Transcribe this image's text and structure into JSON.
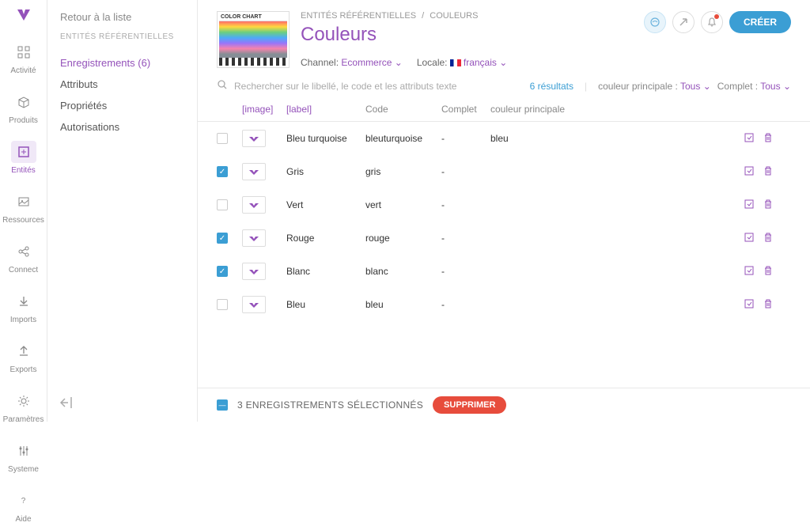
{
  "rail": [
    {
      "label": "Activité",
      "icon": "grid"
    },
    {
      "label": "Produits",
      "icon": "box"
    },
    {
      "label": "Entités",
      "icon": "bracket",
      "active": true
    },
    {
      "label": "Ressources",
      "icon": "image"
    },
    {
      "label": "Connect",
      "icon": "share"
    },
    {
      "label": "Imports",
      "icon": "download"
    },
    {
      "label": "Exports",
      "icon": "upload"
    },
    {
      "label": "Paramètres",
      "icon": "gear"
    },
    {
      "label": "Systeme",
      "icon": "sliders"
    }
  ],
  "rail_help": "Aide",
  "sidebar": {
    "back": "Retour à la liste",
    "section": "ENTITÉS RÉFÉRENTIELLES",
    "items": [
      {
        "label": "Enregistrements (6)",
        "active": true
      },
      {
        "label": "Attributs"
      },
      {
        "label": "Propriétés"
      },
      {
        "label": "Autorisations"
      }
    ]
  },
  "breadcrumb": {
    "parent": "ENTITÉS RÉFÉRENTIELLES",
    "current": "COULEURS"
  },
  "title": "Couleurs",
  "thumb_title": "COLOR CHART",
  "channel": {
    "label": "Channel:",
    "value": "Ecommerce"
  },
  "locale": {
    "label": "Locale:",
    "value": "français"
  },
  "create": "CRÉER",
  "search": {
    "placeholder": "Rechercher sur le libellé, le code et les attributs texte"
  },
  "results": "6 résultats",
  "filter1": {
    "label": "couleur principale :",
    "value": "Tous"
  },
  "filter2": {
    "label": "Complet :",
    "value": "Tous"
  },
  "columns": {
    "image": "[image]",
    "label": "[label]",
    "code": "Code",
    "complet": "Complet",
    "principale": "couleur principale"
  },
  "rows": [
    {
      "label": "Bleu turquoise",
      "code": "bleuturquoise",
      "complet": "-",
      "principale": "bleu",
      "checked": false
    },
    {
      "label": "Gris",
      "code": "gris",
      "complet": "-",
      "principale": "",
      "checked": true
    },
    {
      "label": "Vert",
      "code": "vert",
      "complet": "-",
      "principale": "",
      "checked": false
    },
    {
      "label": "Rouge",
      "code": "rouge",
      "complet": "-",
      "principale": "",
      "checked": true
    },
    {
      "label": "Blanc",
      "code": "blanc",
      "complet": "-",
      "principale": "",
      "checked": true
    },
    {
      "label": "Bleu",
      "code": "bleu",
      "complet": "-",
      "principale": "",
      "checked": false
    }
  ],
  "footer": {
    "text": "3 ENREGISTREMENTS SÉLECTIONNÉS",
    "delete": "SUPPRIMER"
  }
}
